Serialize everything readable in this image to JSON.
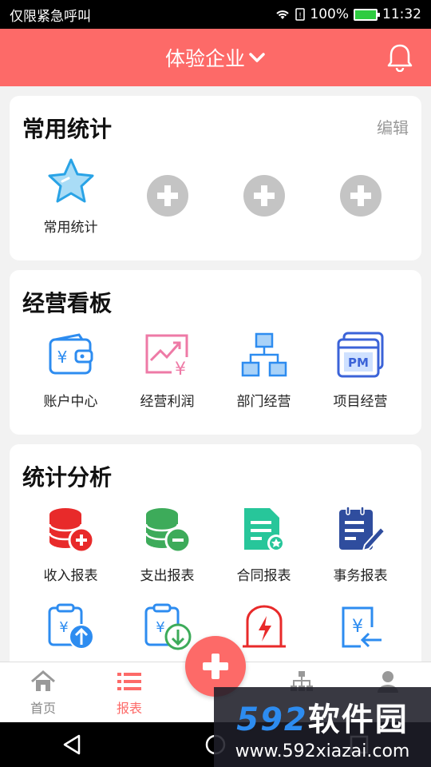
{
  "status_bar": {
    "carrier": "仅限紧急呼叫",
    "battery": "100%",
    "time": "11:32"
  },
  "header": {
    "title": "体验企业",
    "bell_icon": "bell-icon",
    "accent": "#fd6a68"
  },
  "common_stats": {
    "title": "常用统计",
    "edit": "编辑",
    "items": [
      {
        "label": "常用统计",
        "icon": "star-icon"
      },
      {
        "label": "",
        "icon": "add-icon"
      },
      {
        "label": "",
        "icon": "add-icon"
      },
      {
        "label": "",
        "icon": "add-icon"
      }
    ]
  },
  "dashboard": {
    "title": "经营看板",
    "items": [
      {
        "label": "账户中心",
        "icon": "wallet-icon"
      },
      {
        "label": "经营利润",
        "icon": "profit-chart-icon"
      },
      {
        "label": "部门经营",
        "icon": "org-chart-icon"
      },
      {
        "label": "项目经营",
        "icon": "pm-window-icon"
      }
    ]
  },
  "analysis": {
    "title": "统计分析",
    "items": [
      {
        "label": "收入报表",
        "icon": "income-coins-icon"
      },
      {
        "label": "支出报表",
        "icon": "expense-coins-icon"
      },
      {
        "label": "合同报表",
        "icon": "contract-doc-icon"
      },
      {
        "label": "事务报表",
        "icon": "task-note-icon"
      }
    ],
    "row2_icons": [
      "upload-clipboard-icon",
      "download-clipboard-icon",
      "warning-lightning-icon",
      "yuan-return-icon"
    ]
  },
  "tab_bar": {
    "tabs": [
      {
        "label": "首页",
        "icon": "home-icon"
      },
      {
        "label": "报表",
        "icon": "list-icon"
      },
      {
        "label": "",
        "icon": "add-icon"
      },
      {
        "label": "",
        "icon": "hierarchy-icon"
      },
      {
        "label": "",
        "icon": "user-icon"
      }
    ]
  },
  "watermark": {
    "brand_num": "592",
    "brand_text": "软件园",
    "url": "www.592xiazai.com"
  }
}
